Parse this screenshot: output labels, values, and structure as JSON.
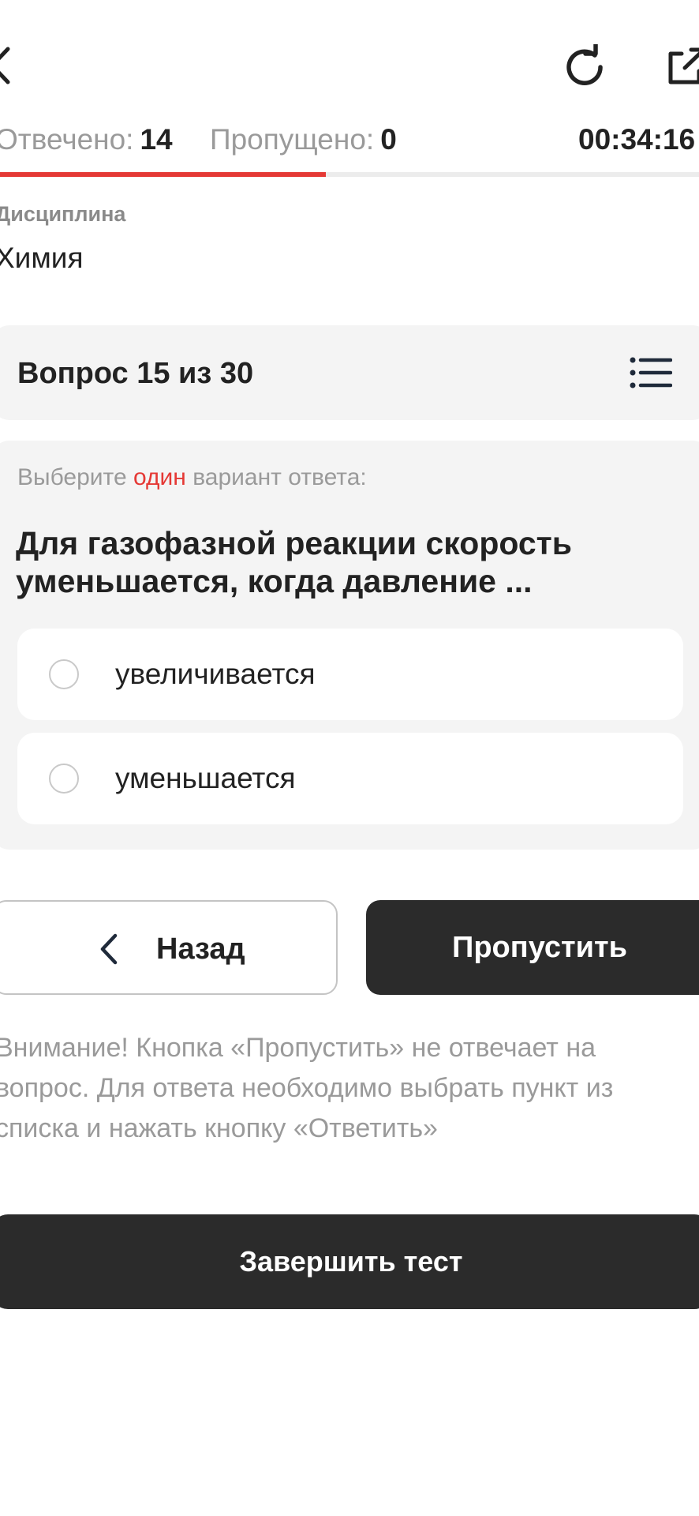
{
  "header": {
    "back_icon": "chevron-left-icon",
    "reload_icon": "reload-icon",
    "share_icon": "external-link-icon"
  },
  "stats": {
    "answered_label": "Отвечено:",
    "answered_value": "14",
    "skipped_label": "Пропущено:",
    "skipped_value": "0",
    "timer": "00:34:16",
    "progress_fraction": 0.4667
  },
  "discipline": {
    "label": "Дисциплина",
    "value": "Химия"
  },
  "question": {
    "title": "Вопрос 15 из 30",
    "list_icon": "list-icon",
    "hint_prefix": "Выберите",
    "hint_accent": "один",
    "hint_suffix": "вариант ответа:",
    "text": "Для газофазной реакции скорость уменьшается, когда давление ...",
    "options": [
      {
        "label": "увеличивается",
        "selected": false
      },
      {
        "label": "уменьшается",
        "selected": false
      }
    ]
  },
  "buttons": {
    "back_label": "Назад",
    "skip_label": "Пропустить",
    "finish_label": "Завершить тест"
  },
  "notice": "Внимание! Кнопка «Пропустить» не отвечает на вопрос. Для ответа необходимо выбрать пункт из списка и нажать кнопку «Ответить»",
  "colors": {
    "accent": "#e53935",
    "dark_button": "#2b2b2b",
    "card_bg": "#f4f4f4",
    "muted_text": "#9a9a9a"
  }
}
